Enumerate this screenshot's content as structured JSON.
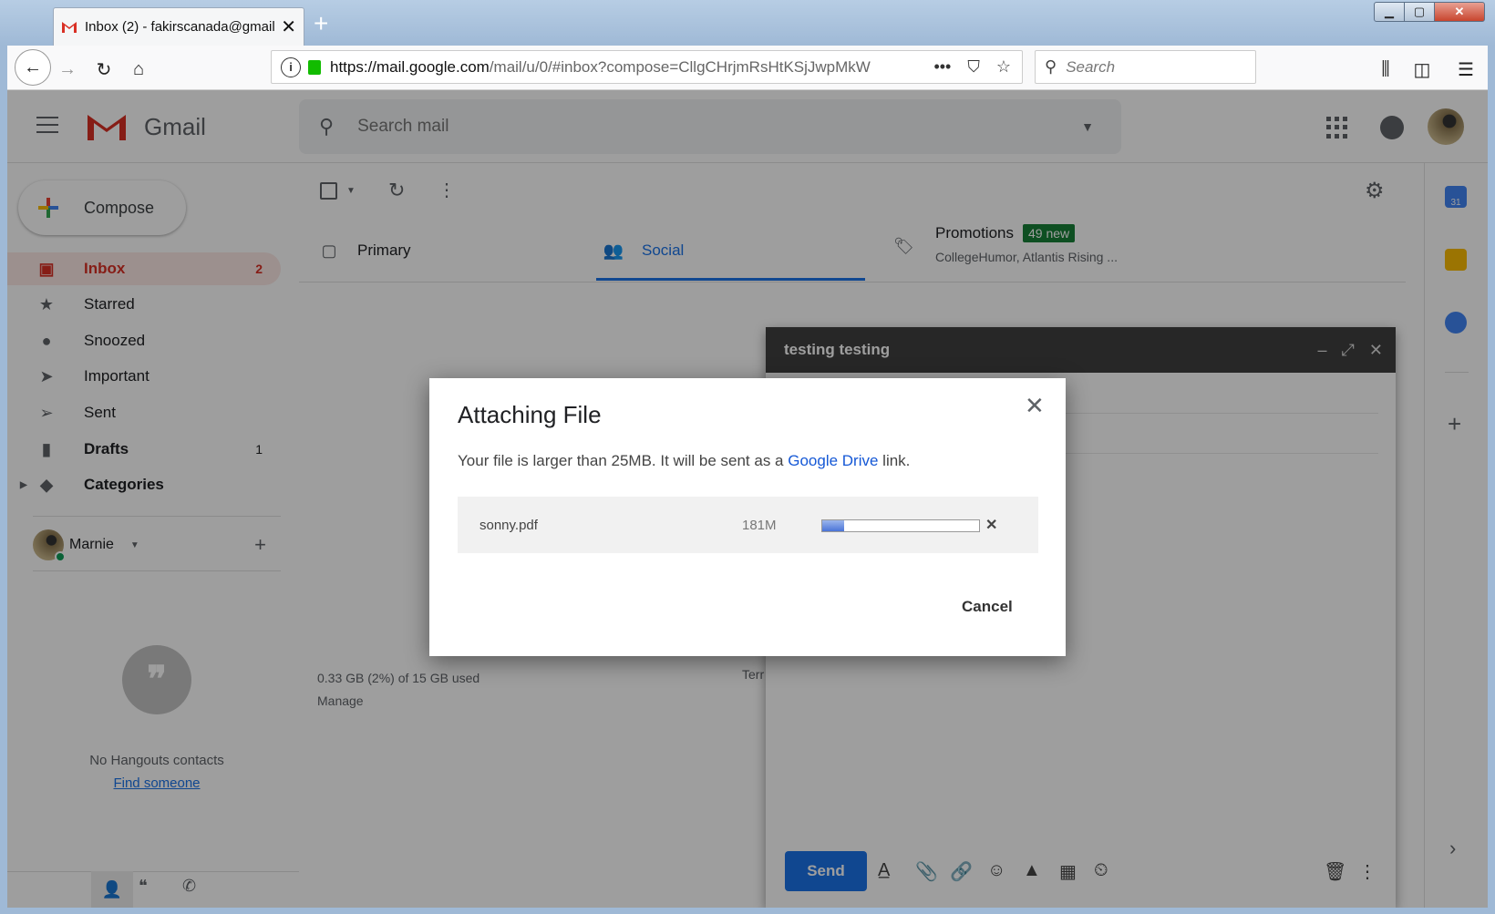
{
  "browser": {
    "tab_title": "Inbox (2) - fakirscanada@gmail",
    "new_tab": "+",
    "url_host": "https://mail.google.com",
    "url_path": "/mail/u/0/#inbox?compose=CllgCHrjmRsHtKSjJwpMkW",
    "search_placeholder": "Search"
  },
  "gmail": {
    "brand": "Gmail",
    "search_placeholder": "Search mail",
    "compose_label": "Compose",
    "nav": [
      {
        "label": "Inbox",
        "count": "2"
      },
      {
        "label": "Starred",
        "count": ""
      },
      {
        "label": "Snoozed",
        "count": ""
      },
      {
        "label": "Important",
        "count": ""
      },
      {
        "label": "Sent",
        "count": ""
      },
      {
        "label": "Drafts",
        "count": "1"
      },
      {
        "label": "Categories",
        "count": ""
      }
    ],
    "hangouts_user": "Marnie",
    "no_hangouts": "No Hangouts contacts",
    "find_someone": "Find someone",
    "tabs": {
      "primary": "Primary",
      "social": "Social",
      "promotions": "Promotions",
      "promotions_badge": "49 new",
      "promotions_sub": "CollegeHumor, Atlantis Rising ..."
    },
    "storage_used": "0.33 GB (2%) of 15 GB used",
    "manage": "Manage",
    "terms": "Terr",
    "calendar_day": "31"
  },
  "compose": {
    "title": "testing testing",
    "send_label": "Send"
  },
  "dialog": {
    "title": "Attaching File",
    "message_pre": "Your file is larger than 25MB. It will be sent as a ",
    "message_link": "Google Drive",
    "message_post": " link.",
    "file_name": "sonny.pdf",
    "file_size": "181M",
    "upload_progress": 0.14,
    "cancel_label": "Cancel"
  },
  "colors": {
    "accent_blue": "#1a73e8",
    "inbox_red": "#d93025",
    "promo_green": "#188038"
  }
}
